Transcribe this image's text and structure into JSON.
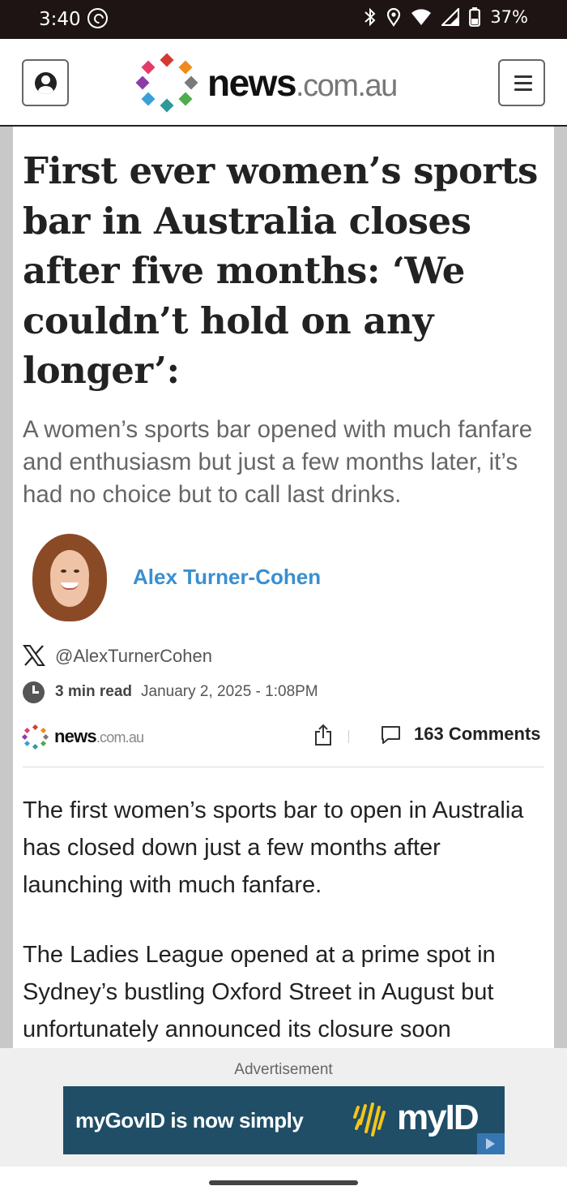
{
  "status_bar": {
    "time": "3:40",
    "battery": "37%"
  },
  "header": {
    "logo_bold": "news",
    "logo_light": ".com.au",
    "brand_colors": [
      "#d63a2f",
      "#f08a1e",
      "#8d3ca6",
      "#7a7a7a",
      "#3aa0d8",
      "#2e9a9a",
      "#4cae4c",
      "#e53b6a"
    ]
  },
  "article": {
    "headline": "First ever women’s sports bar in Australia closes after five months: ‘We couldn’t hold on any longer’:",
    "standfirst": "A women’s sports bar opened with much fanfare and enthusiasm but just a few months later, it’s had no choice but to call last drinks.",
    "author": {
      "name": "Alex Turner-Cohen",
      "handle": "@AlexTurnerCohen"
    },
    "read_time": "3 min read",
    "date": "January 2, 2025 - 1:08PM",
    "comments": "163 Comments",
    "paragraphs": [
      "The first women’s sports bar to open in Australia has closed down just a few months after launching with much fanfare.",
      "The Ladies League opened at a prime spot in Sydney’s bustling Oxford Street in August but unfortunately announced its closure soon afterwards, on New Year’s Day."
    ]
  },
  "ad": {
    "label": "Advertisement",
    "text": "myGovID is now simply",
    "brand": "myID",
    "background": "#1f4e66"
  }
}
